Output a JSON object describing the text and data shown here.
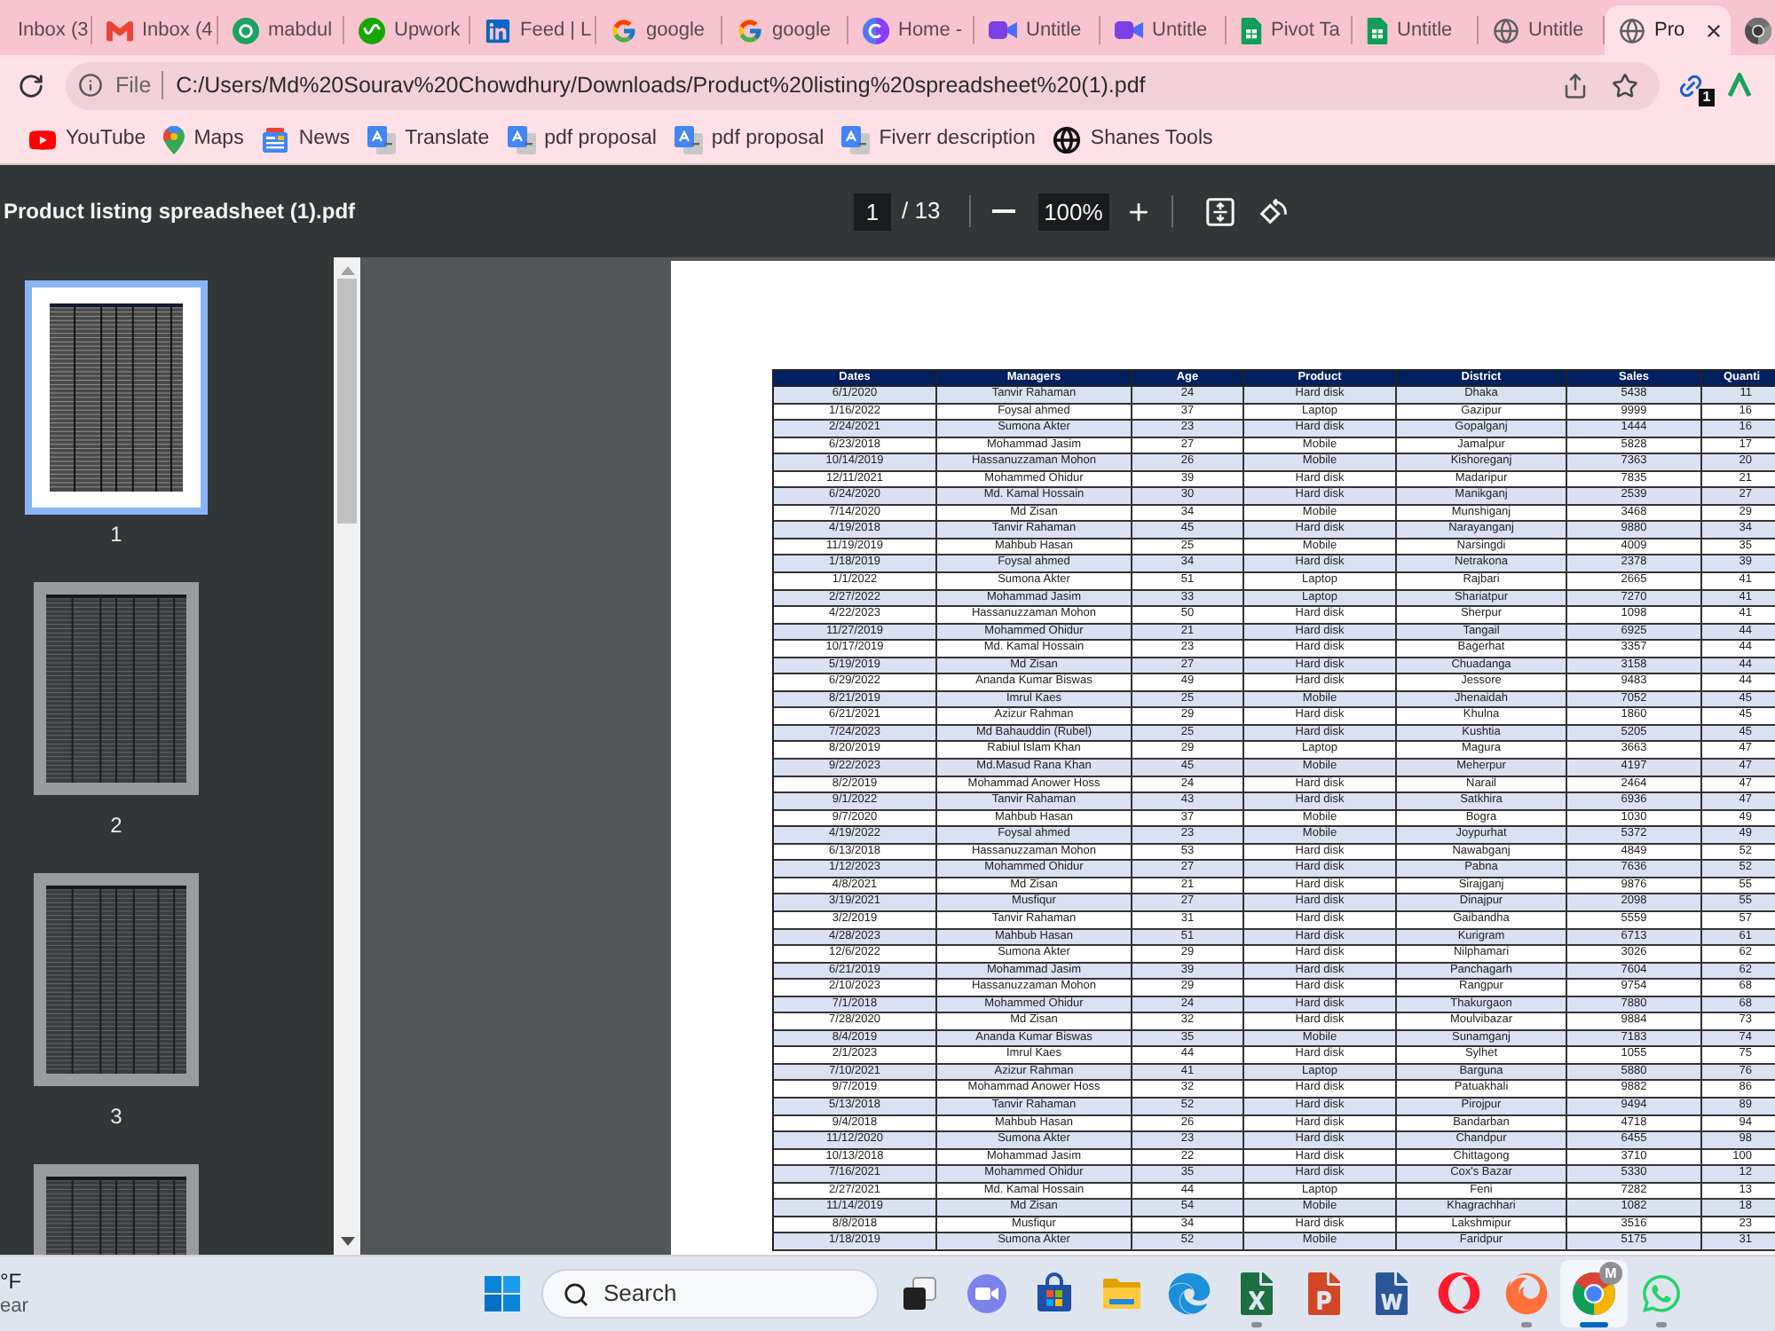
{
  "browser": {
    "tabs": [
      {
        "title": "Inbox (3",
        "selected": false
      },
      {
        "kind": "gmail",
        "title": "Inbox (4",
        "selected": false
      },
      {
        "kind": "circle",
        "title": "mabdul",
        "selected": false
      },
      {
        "kind": "upwork",
        "title": "Upwork",
        "selected": false
      },
      {
        "kind": "linkedin",
        "title": "Feed | L",
        "selected": false
      },
      {
        "kind": "google",
        "title": "google",
        "selected": false
      },
      {
        "kind": "google",
        "title": "google",
        "selected": false
      },
      {
        "kind": "canva",
        "title": "Home -",
        "selected": false
      },
      {
        "kind": "video",
        "title": "Untitle",
        "selected": false
      },
      {
        "kind": "video",
        "title": "Untitle",
        "selected": false
      },
      {
        "kind": "sheets",
        "title": "Pivot Ta",
        "selected": false
      },
      {
        "kind": "sheets",
        "title": "Untitle",
        "selected": false
      },
      {
        "kind": "globe",
        "title": "Untitle",
        "selected": false
      },
      {
        "kind": "globe",
        "title": "Pro",
        "selected": true
      },
      {
        "kind": "chrome",
        "selected": false
      }
    ],
    "address": {
      "scheme_label": "File",
      "url": "C:/Users/Md%20Sourav%20Chowdhury/Downloads/Product%20listing%20spreadsheet%20(1).pdf"
    },
    "extension_badge": "1",
    "bookmarks": [
      {
        "kind": "youtube",
        "label": "YouTube"
      },
      {
        "kind": "maps",
        "label": "Maps"
      },
      {
        "kind": "news",
        "label": "News"
      },
      {
        "kind": "translate",
        "label": "Translate"
      },
      {
        "kind": "translate",
        "label": "pdf proposal"
      },
      {
        "kind": "translate",
        "label": "pdf proposal"
      },
      {
        "kind": "translate",
        "label": "Fiverr description"
      },
      {
        "kind": "globe",
        "label": "Shanes Tools"
      }
    ]
  },
  "pdf_viewer": {
    "file_name": "Product listing spreadsheet (1).pdf",
    "page_number": "1",
    "page_count": "/ 13",
    "zoom": "100%",
    "thumbnails": [
      {
        "label": "1",
        "selected": true
      },
      {
        "label": "2",
        "selected": false
      },
      {
        "label": "3",
        "selected": false
      },
      {
        "selected": false
      }
    ],
    "table": {
      "columns": [
        "Dates",
        "Managers",
        "Age",
        "Product",
        "District",
        "Sales",
        "Quanti"
      ],
      "rows": [
        [
          "6/1/2020",
          "Tanvir Rahaman",
          "24",
          "Hard disk",
          "Dhaka",
          "5438",
          "11"
        ],
        [
          "1/16/2022",
          "Foysal ahmed",
          "37",
          "Laptop",
          "Gazipur",
          "9999",
          "16"
        ],
        [
          "2/24/2021",
          "Sumona Akter",
          "23",
          "Hard disk",
          "Gopalganj",
          "1444",
          "16"
        ],
        [
          "6/23/2018",
          "Mohammad Jasim",
          "27",
          "Mobile",
          "Jamalpur",
          "5828",
          "17"
        ],
        [
          "10/14/2019",
          "Hassanuzzaman Mohon",
          "26",
          "Mobile",
          "Kishoreganj",
          "7363",
          "20"
        ],
        [
          "12/11/2021",
          "Mohammed Ohidur",
          "39",
          "Hard disk",
          "Madaripur",
          "7835",
          "21"
        ],
        [
          "6/24/2020",
          "Md. Kamal Hossain",
          "30",
          "Hard disk",
          "Manikganj",
          "2539",
          "27"
        ],
        [
          "7/14/2020",
          "Md Zisan",
          "34",
          "Mobile",
          "Munshiganj",
          "3468",
          "29"
        ],
        [
          "4/19/2018",
          "Tanvir Rahaman",
          "45",
          "Hard disk",
          "Narayanganj",
          "9880",
          "34"
        ],
        [
          "11/19/2019",
          "Mahbub Hasan",
          "25",
          "Mobile",
          "Narsingdi",
          "4009",
          "35"
        ],
        [
          "1/18/2019",
          "Foysal ahmed",
          "34",
          "Hard disk",
          "Netrakona",
          "2378",
          "39"
        ],
        [
          "1/1/2022",
          "Sumona Akter",
          "51",
          "Laptop",
          "Rajbari",
          "2665",
          "41"
        ],
        [
          "2/27/2022",
          "Mohammad Jasim",
          "33",
          "Laptop",
          "Shariatpur",
          "7270",
          "41"
        ],
        [
          "4/22/2023",
          "Hassanuzzaman Mohon",
          "50",
          "Hard disk",
          "Sherpur",
          "1098",
          "41"
        ],
        [
          "11/27/2019",
          "Mohammed Ohidur",
          "21",
          "Hard disk",
          "Tangail",
          "6925",
          "44"
        ],
        [
          "10/17/2019",
          "Md. Kamal Hossain",
          "23",
          "Hard disk",
          "Bagerhat",
          "3357",
          "44"
        ],
        [
          "5/19/2019",
          "Md Zisan",
          "27",
          "Hard disk",
          "Chuadanga",
          "3158",
          "44"
        ],
        [
          "6/29/2022",
          "Ananda Kumar Biswas",
          "49",
          "Hard disk",
          "Jessore",
          "9483",
          "44"
        ],
        [
          "8/21/2019",
          "Imrul Kaes",
          "25",
          "Mobile",
          "Jhenaidah",
          "7052",
          "45"
        ],
        [
          "6/21/2021",
          "Azizur Rahman",
          "29",
          "Hard disk",
          "Khulna",
          "1860",
          "45"
        ],
        [
          "7/24/2023",
          "Md Bahauddin (Rubel)",
          "25",
          "Hard disk",
          "Kushtia",
          "5205",
          "45"
        ],
        [
          "8/20/2019",
          "Rabiul Islam Khan",
          "29",
          "Laptop",
          "Magura",
          "3663",
          "47"
        ],
        [
          "9/22/2023",
          "Md.Masud Rana Khan",
          "45",
          "Mobile",
          "Meherpur",
          "4197",
          "47"
        ],
        [
          "8/2/2019",
          "Mohammad Anower Hoss",
          "24",
          "Hard disk",
          "Narail",
          "2464",
          "47"
        ],
        [
          "9/1/2022",
          "Tanvir Rahaman",
          "43",
          "Hard disk",
          "Satkhira",
          "6936",
          "47"
        ],
        [
          "9/7/2020",
          "Mahbub Hasan",
          "37",
          "Mobile",
          "Bogra",
          "1030",
          "49"
        ],
        [
          "4/19/2022",
          "Foysal ahmed",
          "23",
          "Mobile",
          "Joypurhat",
          "5372",
          "49"
        ],
        [
          "6/13/2018",
          "Hassanuzzaman Mohon",
          "53",
          "Hard disk",
          "Nawabganj",
          "4849",
          "52"
        ],
        [
          "1/12/2023",
          "Mohammed Ohidur",
          "27",
          "Hard disk",
          "Pabna",
          "7636",
          "52"
        ],
        [
          "4/8/2021",
          "Md Zisan",
          "21",
          "Hard disk",
          "Sirajganj",
          "9876",
          "55"
        ],
        [
          "3/19/2021",
          "Musfiqur",
          "27",
          "Hard disk",
          "Dinajpur",
          "2098",
          "55"
        ],
        [
          "3/2/2019",
          "Tanvir Rahaman",
          "31",
          "Hard disk",
          "Gaibandha",
          "5559",
          "57"
        ],
        [
          "4/28/2023",
          "Mahbub Hasan",
          "51",
          "Hard disk",
          "Kurigram",
          "6713",
          "61"
        ],
        [
          "12/6/2022",
          "Sumona Akter",
          "29",
          "Hard disk",
          "Nilphamari",
          "3026",
          "62"
        ],
        [
          "6/21/2019",
          "Mohammad Jasim",
          "39",
          "Hard disk",
          "Panchagarh",
          "7604",
          "62"
        ],
        [
          "2/10/2023",
          "Hassanuzzaman Mohon",
          "29",
          "Hard disk",
          "Rangpur",
          "9754",
          "68"
        ],
        [
          "7/1/2018",
          "Mohammed Ohidur",
          "24",
          "Hard disk",
          "Thakurgaon",
          "7880",
          "68"
        ],
        [
          "7/28/2020",
          "Md Zisan",
          "32",
          "Hard disk",
          "Moulvibazar",
          "9884",
          "73"
        ],
        [
          "8/4/2019",
          "Ananda Kumar Biswas",
          "35",
          "Mobile",
          "Sunamganj",
          "7183",
          "74"
        ],
        [
          "2/1/2023",
          "Imrul Kaes",
          "44",
          "Hard disk",
          "Sylhet",
          "1055",
          "75"
        ],
        [
          "7/10/2021",
          "Azizur Rahman",
          "41",
          "Laptop",
          "Barguna",
          "5880",
          "76"
        ],
        [
          "9/7/2019",
          "Mohammad Anower Hoss",
          "32",
          "Hard disk",
          "Patuakhali",
          "9882",
          "86"
        ],
        [
          "5/13/2018",
          "Tanvir Rahaman",
          "52",
          "Hard disk",
          "Pirojpur",
          "9494",
          "89"
        ],
        [
          "9/4/2018",
          "Mahbub Hasan",
          "26",
          "Hard disk",
          "Bandarban",
          "4718",
          "94"
        ],
        [
          "11/12/2020",
          "Sumona Akter",
          "23",
          "Hard disk",
          "Chandpur",
          "6455",
          "98"
        ],
        [
          "10/13/2018",
          "Mohammad Jasim",
          "22",
          "Hard disk",
          "Chittagong",
          "3710",
          "100"
        ],
        [
          "7/16/2021",
          "Mohammed Ohidur",
          "35",
          "Hard disk",
          "Cox's Bazar",
          "5330",
          "12"
        ],
        [
          "2/27/2021",
          "Md. Kamal Hossain",
          "44",
          "Laptop",
          "Feni",
          "7282",
          "13"
        ],
        [
          "11/14/2019",
          "Md Zisan",
          "54",
          "Mobile",
          "Khagrachhari",
          "1082",
          "18"
        ],
        [
          "8/8/2018",
          "Musfiqur",
          "34",
          "Hard disk",
          "Lakshmipur",
          "3516",
          "23"
        ],
        [
          "1/18/2019",
          "Sumona Akter",
          "52",
          "Mobile",
          "Faridpur",
          "5175",
          "31"
        ]
      ]
    }
  },
  "taskbar": {
    "weather": {
      "temperature": "°F",
      "condition": "ear"
    },
    "search_label": "Search",
    "apps": [
      {
        "kind": "taskview",
        "running": false,
        "selected": false
      },
      {
        "kind": "meet",
        "running": false,
        "selected": false
      },
      {
        "kind": "store",
        "running": false,
        "selected": false
      },
      {
        "kind": "explorer",
        "running": false,
        "selected": false
      },
      {
        "kind": "edge",
        "running": false,
        "selected": false
      },
      {
        "kind": "excel",
        "running": true,
        "selected": false
      },
      {
        "kind": "powerpoint",
        "running": false,
        "selected": false
      },
      {
        "kind": "word",
        "running": false,
        "selected": false
      },
      {
        "kind": "opera",
        "running": false,
        "selected": false
      },
      {
        "kind": "firefox",
        "running": true,
        "selected": false
      },
      {
        "kind": "chrome",
        "running": true,
        "selected": true,
        "badge": "M"
      },
      {
        "kind": "whatsapp",
        "running": true,
        "selected": false
      }
    ]
  }
}
